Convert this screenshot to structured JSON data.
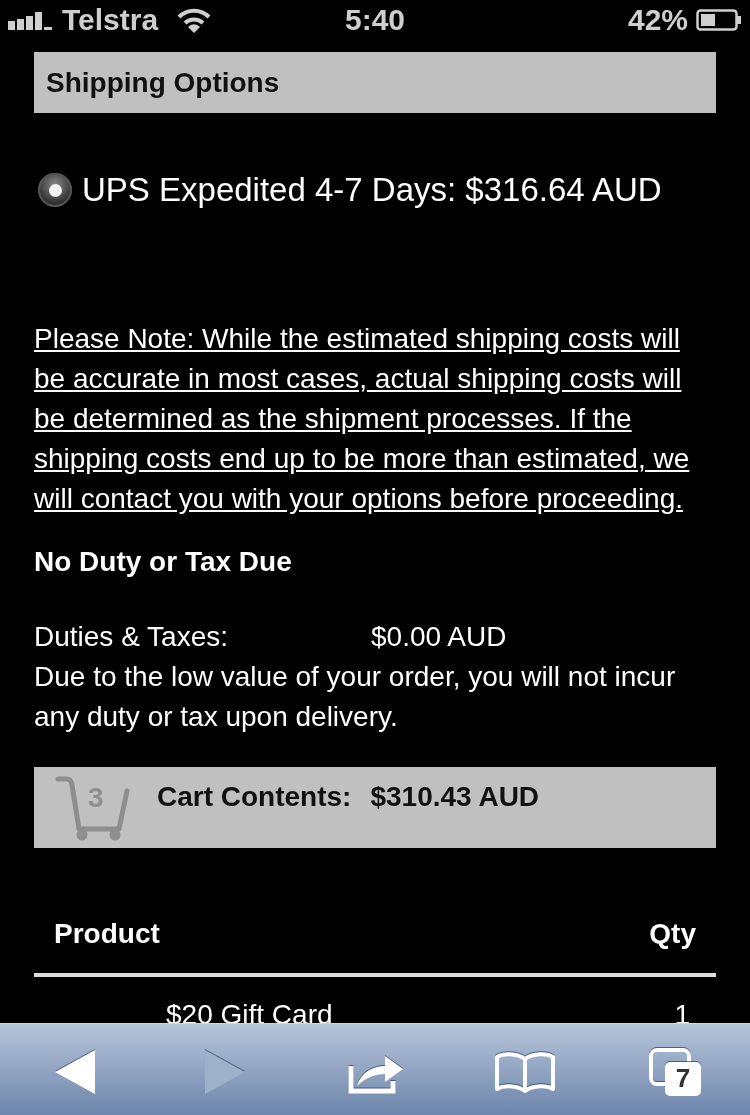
{
  "status_bar": {
    "carrier": "Telstra",
    "time": "5:40",
    "battery": "42%"
  },
  "shipping_options": {
    "title": "Shipping Options",
    "options": [
      {
        "label": "UPS Expedited 4-7 Days: $316.64 AUD",
        "selected": true
      }
    ]
  },
  "note": "Please Note: While the estimated shipping costs will be accurate in most cases, actual shipping costs will be determined as the shipment processes. If the shipping costs end up to be more than estimated, we will contact you with your options before proceeding.",
  "duty": {
    "title": "No Duty or Tax Due",
    "label": "Duties & Taxes:",
    "value": "$0.00 AUD",
    "message": "Due to the low value of your order, you will not incur any duty or tax upon delivery."
  },
  "cart": {
    "count": "3",
    "label": "Cart Contents:",
    "total": "$310.43 AUD"
  },
  "table": {
    "columns": [
      "Product",
      "Qty"
    ],
    "rows": [
      {
        "product": "$20 Gift Card",
        "qty": "1"
      }
    ]
  },
  "toolbar": {
    "buttons": [
      {
        "kind": "back",
        "disabled": false
      },
      {
        "kind": "forward",
        "disabled": true
      },
      {
        "kind": "share",
        "disabled": false
      },
      {
        "kind": "bookmarks",
        "disabled": false
      },
      {
        "kind": "tabs",
        "count": "7",
        "disabled": false
      }
    ]
  }
}
